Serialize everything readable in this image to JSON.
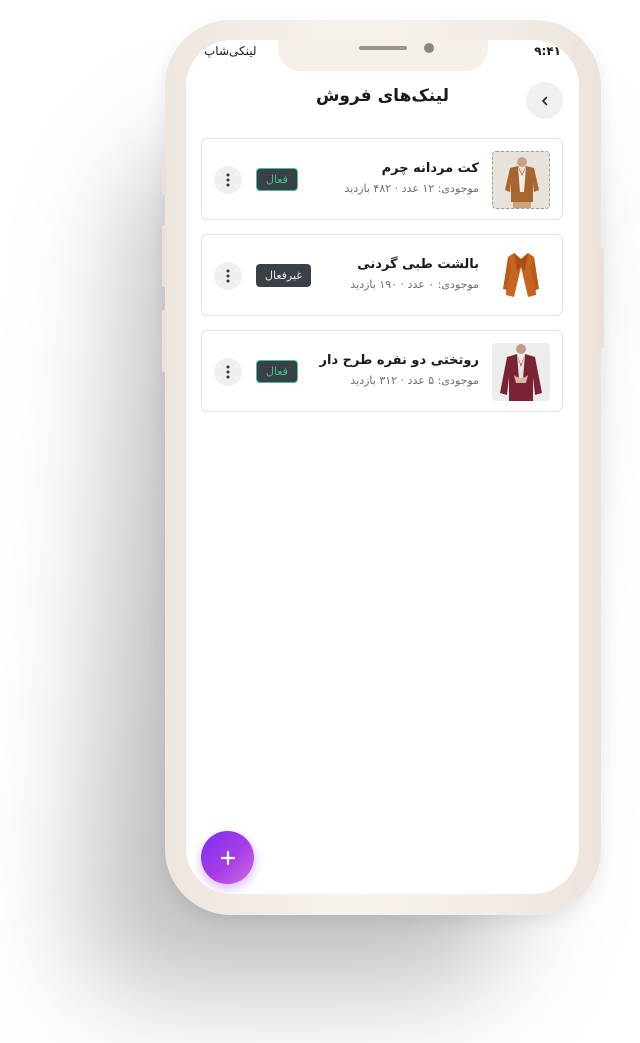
{
  "status_bar": {
    "time": "۹:۴۱",
    "brand": "لینکی‌شاپ"
  },
  "header": {
    "title": "لینک‌های فروش",
    "back_icon": "chevron-left-icon"
  },
  "items": [
    {
      "title": "کت مردانه چرم",
      "meta": "موجودی: ۱۲ عدد · ۴۸۲ بازدید",
      "status": "فعال",
      "status_type": "active",
      "thumb_icon": "brown-jacket-image"
    },
    {
      "title": "بالشت طبی گردنی",
      "meta": "موجودی: ۰ عدد · ۱۹۰ بازدید",
      "status": "غیرفعال",
      "status_type": "inactive",
      "thumb_icon": "orange-coat-image"
    },
    {
      "title": "روتختی دو نفره طرح دار",
      "meta": "موجودی: ۵ عدد · ۳۱۲ بازدید",
      "status": "فعال",
      "status_type": "active",
      "thumb_icon": "burgundy-blazer-image"
    }
  ],
  "fab": {
    "label": "+",
    "icon": "plus-icon"
  },
  "colors": {
    "active_status": "#38c98a",
    "badge_bg": "#3a3f48",
    "fab_start": "#7a2ff0",
    "fab_end": "#d36ae6"
  }
}
